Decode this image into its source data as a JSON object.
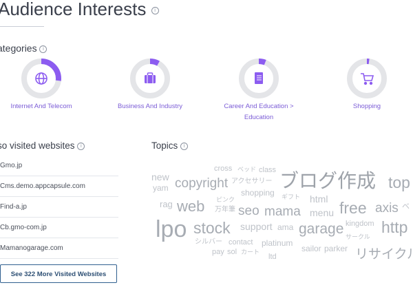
{
  "page": {
    "title": "Audience Interests",
    "categories_heading": "ategories",
    "sites_heading": "so visited websites",
    "topics_heading": "Topics"
  },
  "colors": {
    "accent": "#8c5cf0",
    "track": "#e4e5e8",
    "link": "#7b5cd6",
    "button_border": "#2f5f8f"
  },
  "categories": [
    {
      "line1": "Internet And Telecom",
      "line2": "",
      "icon": "globe-icon",
      "share": 0.27
    },
    {
      "line1": "Business And Industry",
      "line2": "",
      "icon": "briefcase-icon",
      "share": 0.08
    },
    {
      "line1": "Career And Education >",
      "line2": "Education",
      "icon": "book-icon",
      "share": 0.06
    },
    {
      "line1": "Shopping",
      "line2": "",
      "icon": "cart-icon",
      "share": 0.02
    }
  ],
  "websites": [
    "Gmo.jp",
    "Cms.demo.appcapsule.com",
    "Find-a.jp",
    "Cb.gmo-com.jp",
    "Mamanogarage.com"
  ],
  "more_button": "See 322 More Visited Websites",
  "topics": [
    "cross",
    "ベッド",
    "class",
    "new",
    "copyright",
    "アクセサリー",
    "ブログ作成",
    "top",
    "yam",
    "ピンク",
    "shopping",
    "rag",
    "web",
    "万年筆",
    "seo",
    "mama",
    "ギフト",
    "html",
    "menu",
    "free",
    "axis",
    "ベ",
    "kingdom",
    "lpo",
    "stock",
    "support",
    "ama",
    "garage",
    "http",
    "シルバー",
    "contact",
    "サークル",
    "platinum",
    "pay",
    "sol",
    "カート",
    "sailor",
    "parker",
    "ltd",
    "リサイクル"
  ]
}
